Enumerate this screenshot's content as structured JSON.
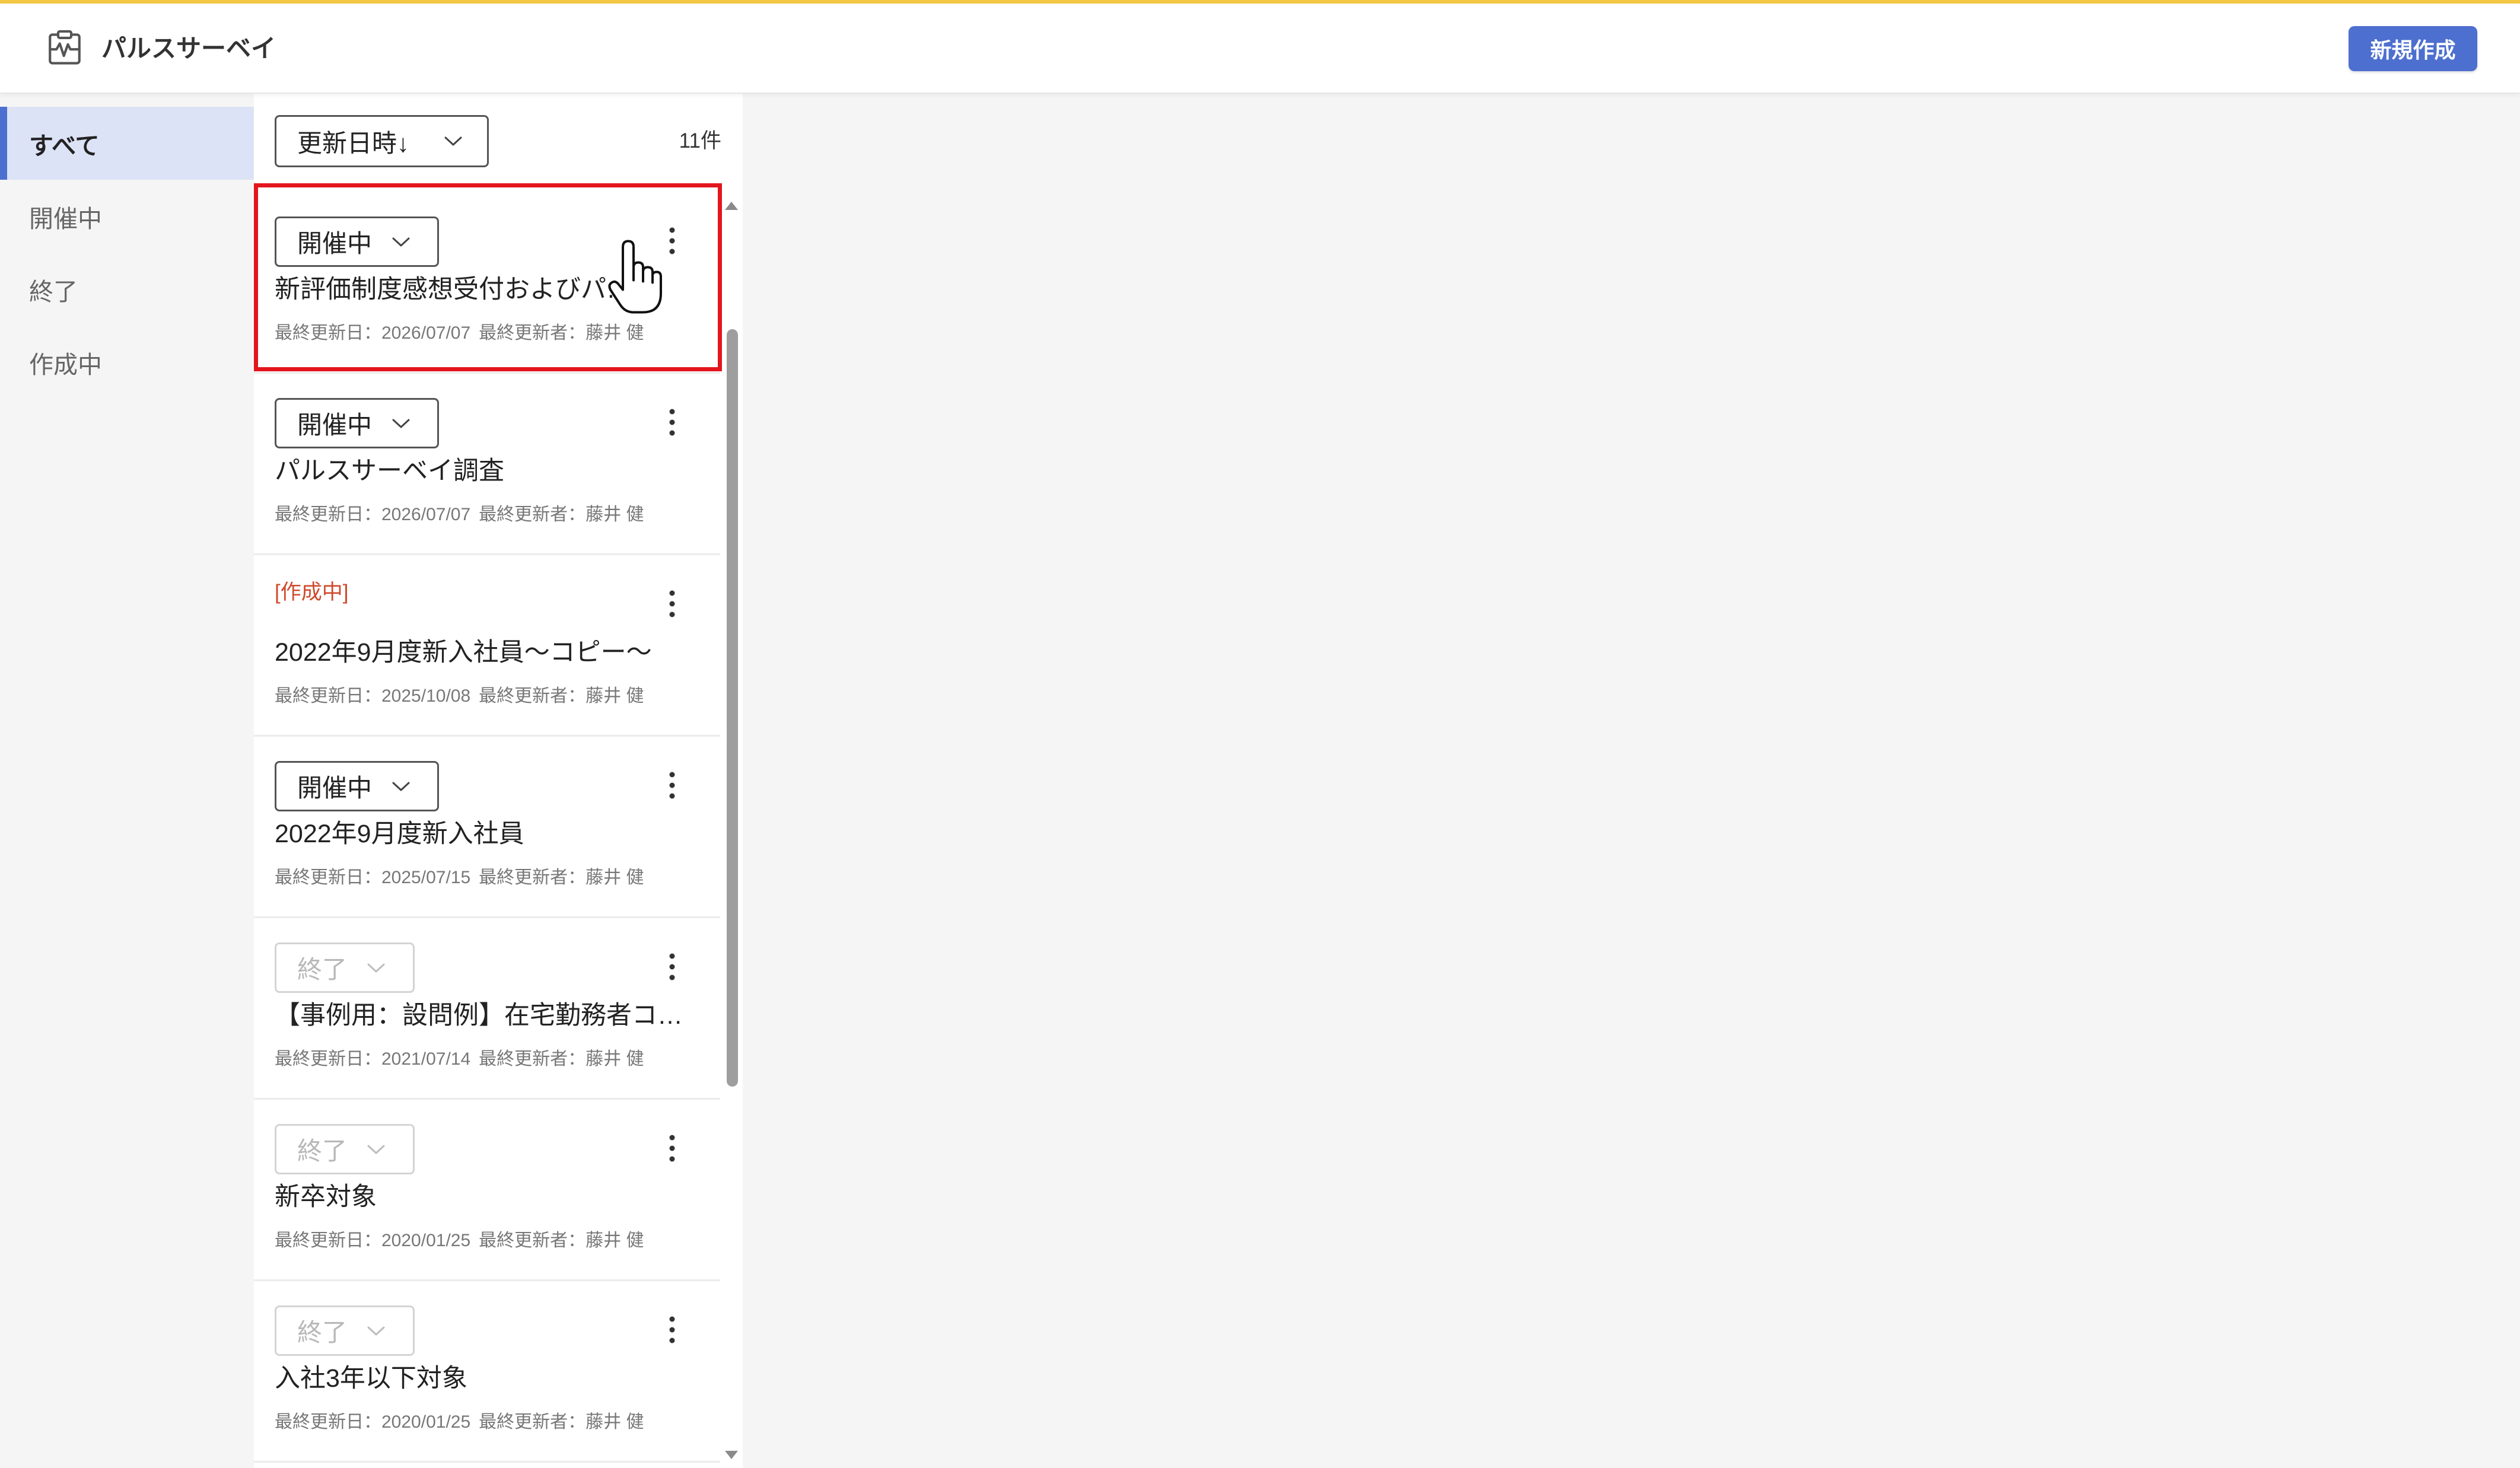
{
  "app": {
    "title": "パルスサーベイ",
    "logo_icon": "pulse-survey-icon"
  },
  "header": {
    "new_button_label": "新規作成"
  },
  "colors": {
    "top_accent": "#f2c744",
    "primary": "#4d6fcf",
    "selected_bg": "#dde3f6",
    "draft_tag": "#cf4a2c",
    "highlight": "#e3151d"
  },
  "sidebar": {
    "items": [
      {
        "label": "すべて",
        "selected": true
      },
      {
        "label": "開催中",
        "selected": false
      },
      {
        "label": "終了",
        "selected": false
      },
      {
        "label": "作成中",
        "selected": false
      }
    ]
  },
  "list": {
    "sort_label": "更新日時↓",
    "sort_icon": "chevron-down-icon",
    "count_label": "11件",
    "item_menu_icon": "kebab-menu-icon",
    "meta_labels": {
      "updated_date": "最終更新日：",
      "updated_by": "最終更新者："
    },
    "items": [
      {
        "status": "開催中",
        "title": "新評価制度感想受付およびパ…",
        "updated_date": "2026/07/07",
        "updated_by": "藤井 健"
      },
      {
        "status": "開催中",
        "title": "パルスサーベイ調査",
        "updated_date": "2026/07/07",
        "updated_by": "藤井 健"
      },
      {
        "status": "[作成中]",
        "title": "2022年9月度新入社員～コピー～",
        "updated_date": "2025/10/08",
        "updated_by": "藤井 健"
      },
      {
        "status": "開催中",
        "title": "2022年9月度新入社員",
        "updated_date": "2025/07/15",
        "updated_by": "藤井 健"
      },
      {
        "status": "終了",
        "title": "【事例用：設問例】在宅勤務者コ…",
        "updated_date": "2021/07/14",
        "updated_by": "藤井 健"
      },
      {
        "status": "終了",
        "title": "新卒対象",
        "updated_date": "2020/01/25",
        "updated_by": "藤井 健"
      },
      {
        "status": "終了",
        "title": "入社3年以下対象",
        "updated_date": "2020/01/25",
        "updated_by": "藤井 健"
      }
    ]
  },
  "overlay": {
    "cursor_icon": "hand-pointer-icon"
  }
}
